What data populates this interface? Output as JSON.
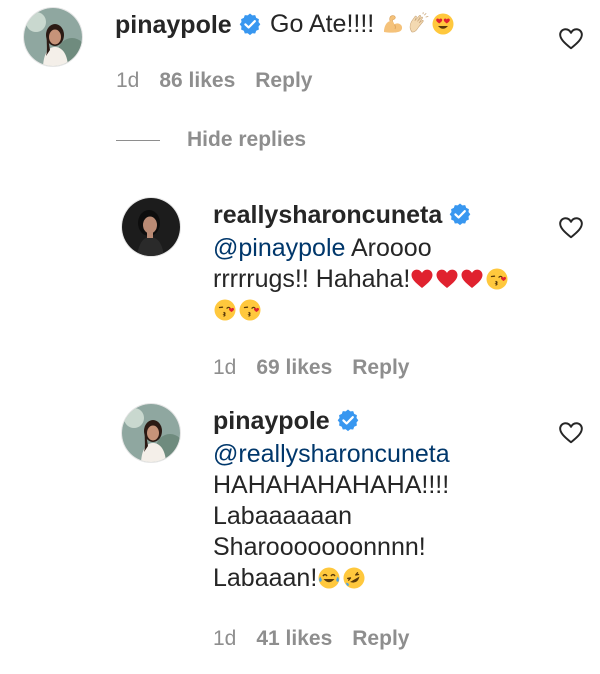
{
  "comments": [
    {
      "username": "pinaypole",
      "text": "Go Ate!!!!",
      "emojis": [
        "flexed-biceps",
        "clapping-hands",
        "heart-eyes-face"
      ],
      "time": "1d",
      "likes": "86 likes",
      "reply": "Reply"
    }
  ],
  "hide_replies_label": "Hide replies",
  "replies": [
    {
      "username": "reallysharoncuneta",
      "mention": "@pinaypole",
      "line1_rest": " Aroooo",
      "line2": "rrrrrugs!! Hahaha!",
      "emojis_line2": [
        "red-heart",
        "red-heart",
        "red-heart",
        "kissing-face"
      ],
      "emojis_line3": [
        "kissing-face",
        "kissing-face"
      ],
      "time": "1d",
      "likes": "69 likes",
      "reply": "Reply"
    },
    {
      "username": "pinaypole",
      "mention": "@reallysharoncuneta",
      "line2": "HAHAHAHAHAHA!!!!",
      "line3": "Labaaaaaan",
      "line4": "Sharooooooonnnn!",
      "line5": "Labaaan!",
      "emojis_line5": [
        "tears-of-joy-face",
        "rolling-laughing-face"
      ],
      "time": "1d",
      "likes": "41 likes",
      "reply": "Reply"
    }
  ],
  "colors": {
    "text": "#262626",
    "secondary": "#8e8e8e",
    "mention": "#00376b",
    "verified": "#3897f0"
  }
}
